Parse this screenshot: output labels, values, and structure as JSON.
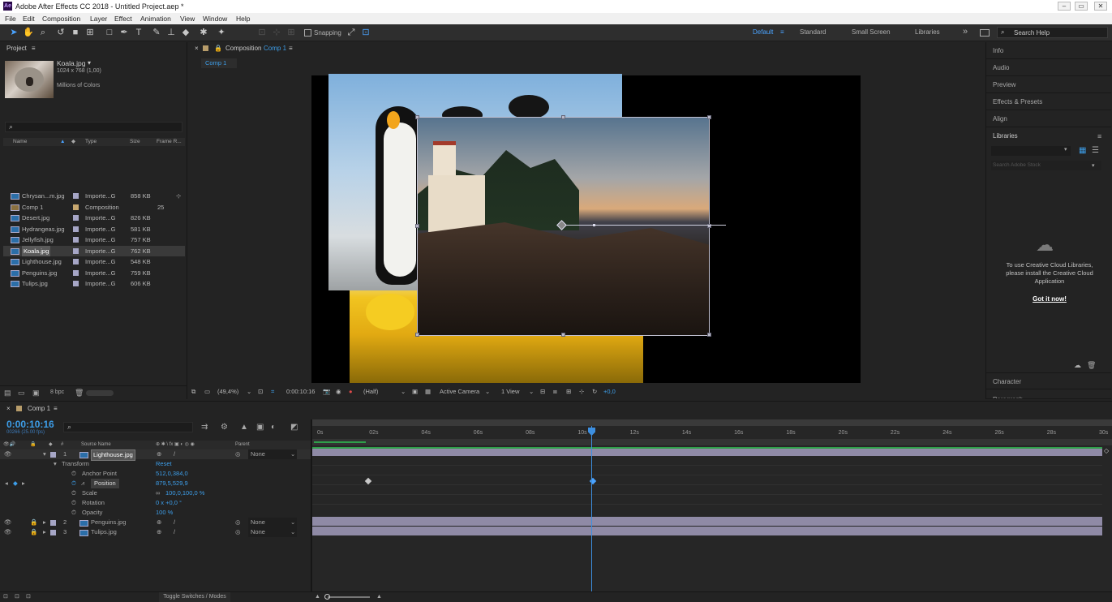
{
  "app": {
    "icon": "Ae",
    "title": "Adobe After Effects CC 2018 - Untitled Project.aep *"
  },
  "window_controls": {
    "minimize": "–",
    "maximize": "▭",
    "close": "✕"
  },
  "menu": [
    "File",
    "Edit",
    "Composition",
    "Layer",
    "Effect",
    "Animation",
    "View",
    "Window",
    "Help"
  ],
  "toolbar": {
    "snapping": "Snapping",
    "workspaces": [
      "Default",
      "Standard",
      "Small Screen",
      "Libraries"
    ],
    "more": "»",
    "search_placeholder": "Search Help"
  },
  "project": {
    "title": "Project",
    "preview_name": "Koala.jpg",
    "preview_dims": "1024 x 768 (1,00)",
    "preview_colors": "Millions of Colors",
    "columns": {
      "name": "Name",
      "type": "Type",
      "size": "Size",
      "frame": "Frame R..."
    },
    "items": [
      {
        "name": "Chrysan...m.jpg",
        "type": "Importe...G",
        "size": "858 KB",
        "frame": ""
      },
      {
        "name": "Comp 1",
        "type": "Composition",
        "size": "",
        "frame": "25"
      },
      {
        "name": "Desert.jpg",
        "type": "Importe...G",
        "size": "826 KB",
        "frame": ""
      },
      {
        "name": "Hydrangeas.jpg",
        "type": "Importe...G",
        "size": "581 KB",
        "frame": ""
      },
      {
        "name": "Jellyfish.jpg",
        "type": "Importe...G",
        "size": "757 KB",
        "frame": ""
      },
      {
        "name": "Koala.jpg",
        "type": "Importe...G",
        "size": "762 KB",
        "frame": ""
      },
      {
        "name": "Lighthouse.jpg",
        "type": "Importe...G",
        "size": "548 KB",
        "frame": ""
      },
      {
        "name": "Penguins.jpg",
        "type": "Importe...G",
        "size": "759 KB",
        "frame": ""
      },
      {
        "name": "Tulips.jpg",
        "type": "Importe...G",
        "size": "606 KB",
        "frame": ""
      }
    ],
    "footer_bpc": "8 bpc"
  },
  "composition": {
    "tab_label": "Composition",
    "comp_name": "Comp 1",
    "subtab": "Comp 1",
    "viewer_bar": {
      "zoom": "(49,4%)",
      "timecode": "0:00:10:16",
      "resolution": "(Half)",
      "camera": "Active Camera",
      "views": "1 View",
      "exposure": "+0,0"
    }
  },
  "right_panel": {
    "items": [
      "Info",
      "Audio",
      "Preview",
      "Effects & Presets",
      "Align"
    ],
    "libraries_title": "Libraries",
    "stock_placeholder": "Search Adobe Stock",
    "cc_message": "To use Creative Cloud Libraries, please install the Creative Cloud Application",
    "cc_link": "Got it now!",
    "bottom_items": [
      "Character",
      "Paragraph"
    ]
  },
  "timeline": {
    "tab": "Comp 1",
    "timecode": "0:00:10:16",
    "frames": "00266 (25.00 fps)",
    "col_source": "Source Name",
    "col_parent": "Parent",
    "layers": [
      {
        "num": "1",
        "name": "Lighthouse.jpg",
        "parent": "None"
      },
      {
        "num": "2",
        "name": "Penguins.jpg",
        "parent": "None"
      },
      {
        "num": "3",
        "name": "Tulips.jpg",
        "parent": "None"
      }
    ],
    "transform": {
      "label": "Transform",
      "reset": "Reset",
      "props": [
        {
          "name": "Anchor Point",
          "value": "512,0,384,0"
        },
        {
          "name": "Position",
          "value": "879,5,529,9"
        },
        {
          "name": "Scale",
          "value": "100,0,100,0 %"
        },
        {
          "name": "Rotation",
          "value": "0 x +0,0 °"
        },
        {
          "name": "Opacity",
          "value": "100 %"
        }
      ]
    },
    "ticks": [
      "0s",
      "02s",
      "04s",
      "06s",
      "08s",
      "10s",
      "12s",
      "14s",
      "16s",
      "18s",
      "20s",
      "22s",
      "24s",
      "26s",
      "28s",
      "30s"
    ],
    "toggle_label": "Toggle Switches / Modes"
  }
}
